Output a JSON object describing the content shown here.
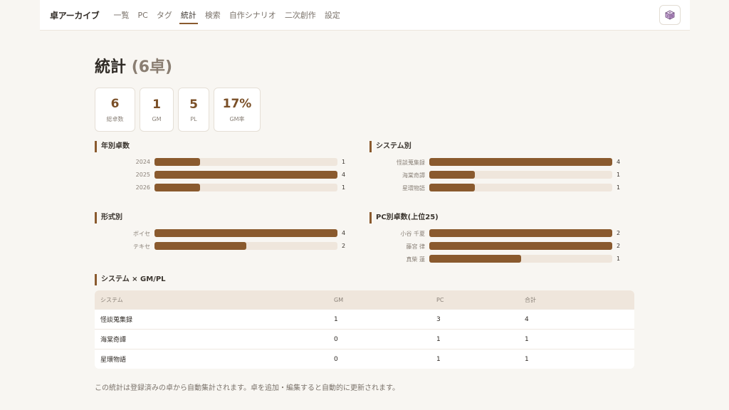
{
  "header": {
    "brand": "卓アーカイブ",
    "nav": [
      "一覧",
      "PC",
      "タグ",
      "統計",
      "検索",
      "自作シナリオ",
      "二次創作",
      "設定"
    ],
    "active_nav": "統計",
    "dice_icon": "dice-icon"
  },
  "page": {
    "title": "統計",
    "subtitle": "(6卓)"
  },
  "summary_cards": [
    {
      "value": "6",
      "label": "総卓数"
    },
    {
      "value": "1",
      "label": "GM"
    },
    {
      "value": "5",
      "label": "PL"
    },
    {
      "value": "17%",
      "label": "GM率"
    }
  ],
  "by_year": {
    "title": "年別卓数",
    "rows": [
      {
        "label": "2024",
        "value": 1
      },
      {
        "label": "2025",
        "value": 4
      },
      {
        "label": "2026",
        "value": 1
      }
    ],
    "max": 4
  },
  "by_system": {
    "title": "システム別",
    "rows": [
      {
        "label": "怪談蒐集録",
        "value": 4
      },
      {
        "label": "海棠奇譚",
        "value": 1
      },
      {
        "label": "星環物語",
        "value": 1
      }
    ],
    "max": 4
  },
  "by_format": {
    "title": "形式別",
    "rows": [
      {
        "label": "ボイセ",
        "value": 4
      },
      {
        "label": "テキセ",
        "value": 2
      }
    ],
    "max": 4
  },
  "by_pc": {
    "title": "PC別卓数(上位25)",
    "rows": [
      {
        "label": "小谷 千夏",
        "value": 2
      },
      {
        "label": "藤宮 律",
        "value": 2
      },
      {
        "label": "真柴 蓮",
        "value": 1
      }
    ],
    "max": 2
  },
  "system_table": {
    "title": "システム × GM/PL",
    "headers": [
      "システム",
      "GM",
      "PC",
      "合計"
    ],
    "rows": [
      [
        "怪談蒐集録",
        "1",
        "3",
        "4"
      ],
      [
        "海棠奇譚",
        "0",
        "1",
        "1"
      ],
      [
        "星環物語",
        "0",
        "1",
        "1"
      ]
    ]
  },
  "footer_note": "この統計は登録済みの卓から自動集計されます。卓を追加・編集すると自動的に更新されます。",
  "colors": {
    "accent": "#8a5a2e",
    "track": "#efe6dc",
    "background": "#f8f6f2"
  }
}
